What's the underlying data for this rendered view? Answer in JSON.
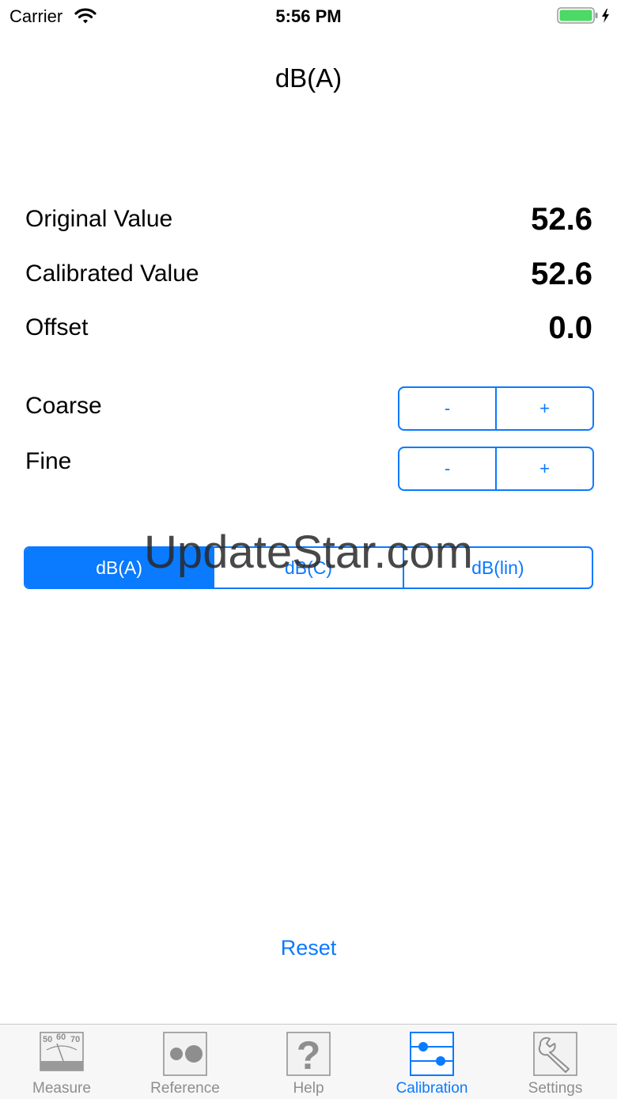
{
  "status_bar": {
    "carrier": "Carrier",
    "time": "5:56 PM"
  },
  "nav": {
    "title": "dB(A)"
  },
  "readings": {
    "original_label": "Original Value",
    "original_value": "52.6",
    "calibrated_label": "Calibrated Value",
    "calibrated_value": "52.6",
    "offset_label": "Offset",
    "offset_value": "0.0"
  },
  "adjust": {
    "coarse_label": "Coarse",
    "fine_label": "Fine",
    "minus": "-",
    "plus": "+"
  },
  "weighting": {
    "options": [
      "dB(A)",
      "dB(C)",
      "dB(lin)"
    ],
    "selected": "dB(A)"
  },
  "watermark": "UpdateStar.com",
  "reset_label": "Reset",
  "tabs": [
    {
      "label": "Measure",
      "icon": "meter-icon"
    },
    {
      "label": "Reference",
      "icon": "reference-dots-icon"
    },
    {
      "label": "Help",
      "icon": "question-icon"
    },
    {
      "label": "Calibration",
      "icon": "sliders-icon",
      "active": true
    },
    {
      "label": "Settings",
      "icon": "wrench-icon"
    }
  ],
  "meter_icon_scale": [
    "50",
    "60",
    "70"
  ],
  "help_icon_glyph": "?",
  "colors": {
    "accent": "#0a7aff",
    "battery": "#4cd964",
    "tab_inactive": "#8e8e8e"
  }
}
